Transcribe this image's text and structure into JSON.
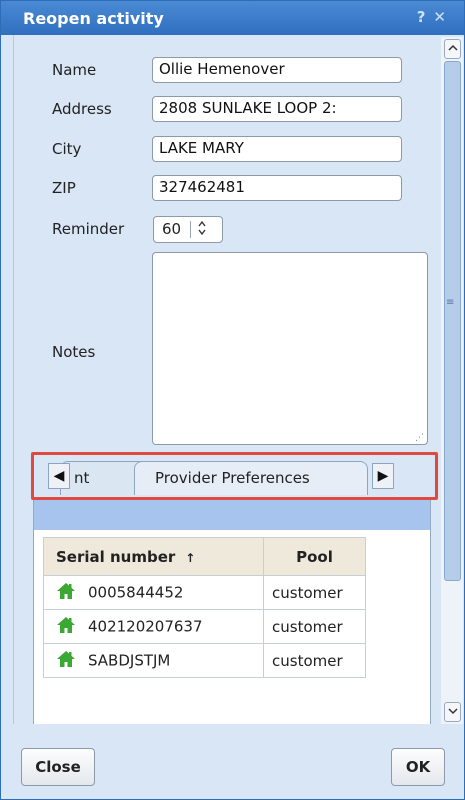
{
  "dialog": {
    "title": "Reopen activity",
    "help_glyph": "?",
    "close_glyph": "✕"
  },
  "form": {
    "name_label": "Name",
    "name_value": "Ollie Hemenover",
    "address_label": "Address",
    "address_value": "2808  SUNLAKE LOOP  2:",
    "city_label": "City",
    "city_value": "LAKE MARY",
    "zip_label": "ZIP",
    "zip_value": "327462481",
    "reminder_label": "Reminder",
    "reminder_value": "60",
    "notes_label": "Notes",
    "notes_value": ""
  },
  "tabs": {
    "left_arrow": "◀",
    "right_arrow": "▶",
    "partial_tab_label": "nt",
    "provider_tab_label": "Provider Preferences"
  },
  "table": {
    "col_serial": "Serial number",
    "sort_glyph": "↑",
    "col_pool": "Pool",
    "rows": [
      {
        "serial": "0005844452",
        "pool": "customer"
      },
      {
        "serial": "402120207637",
        "pool": "customer"
      },
      {
        "serial": "SABDJSTJM",
        "pool": "customer"
      }
    ]
  },
  "buttons": {
    "close_label": "Close",
    "ok_label": "OK"
  },
  "colors": {
    "titlebar": "#2f6fbf",
    "highlight_border": "#e0493d",
    "house_icon": "#3aa832"
  },
  "icons": {
    "row_icon": "house-icon",
    "reminder_spinner": "up-down-spinner-icon"
  }
}
